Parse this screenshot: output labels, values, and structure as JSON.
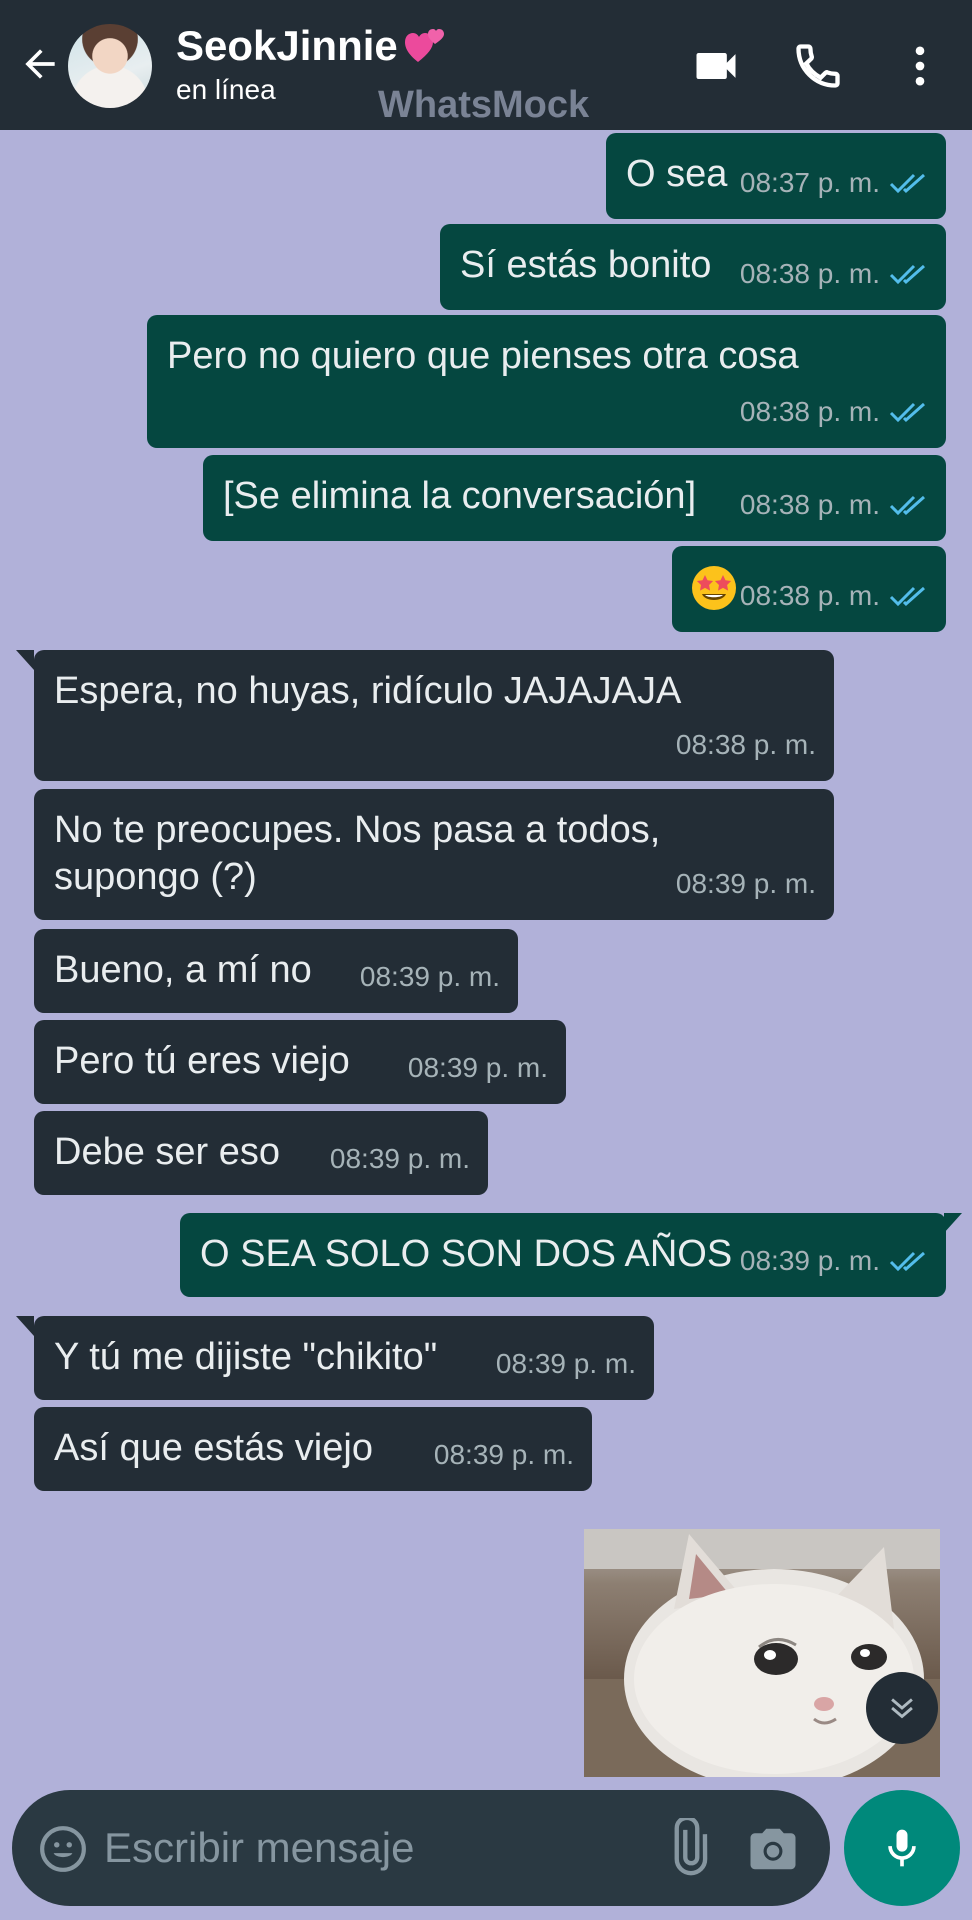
{
  "header": {
    "contact_name": "SeokJinnie",
    "status": "en línea",
    "watermark": "WhatsMock"
  },
  "messages": [
    {
      "dir": "out",
      "text": "O sea",
      "time": "08:37 p. m.",
      "read": true
    },
    {
      "dir": "out",
      "text": "Sí estás bonito",
      "time": "08:38 p. m.",
      "read": true
    },
    {
      "dir": "out",
      "text": "Pero no quiero que pienses otra cosa",
      "time": "08:38 p. m.",
      "read": true
    },
    {
      "dir": "out",
      "text": "[Se elimina la conversación]",
      "time": "08:38 p. m.",
      "read": true
    },
    {
      "dir": "out",
      "text": "",
      "emoji": "star-struck-emoji",
      "time": "08:38 p. m.",
      "read": true
    },
    {
      "dir": "in",
      "text": "Espera, no huyas, ridículo JAJAJAJA",
      "time": "08:38 p. m."
    },
    {
      "dir": "in",
      "text": "No te preocupes. Nos pasa a todos,",
      "text2": "supongo (?)",
      "time": "08:39 p. m."
    },
    {
      "dir": "in",
      "text": "Bueno, a mí no",
      "time": "08:39 p. m."
    },
    {
      "dir": "in",
      "text": "Pero tú eres viejo",
      "time": "08:39 p. m."
    },
    {
      "dir": "in",
      "text": "Debe ser eso",
      "time": "08:39 p. m."
    },
    {
      "dir": "out",
      "text": "O SEA SOLO SON DOS AÑOS",
      "time": "08:39 p. m.",
      "read": true
    },
    {
      "dir": "in",
      "text": "Y tú me dijiste \"chikito\"",
      "time": "08:39 p. m."
    },
    {
      "dir": "in",
      "text": "Así que estás viejo",
      "time": "08:39 p. m."
    }
  ],
  "sticker": {
    "subject": "crying-cat-sticker"
  },
  "composer": {
    "placeholder": "Escribir mensaje"
  },
  "icons": {
    "back": "arrow-left-icon",
    "video": "video-call-icon",
    "call": "phone-icon",
    "menu": "more-vert-icon",
    "emoji": "emoji-icon",
    "attach": "paperclip-icon",
    "camera": "camera-icon",
    "mic": "microphone-icon",
    "scroll": "double-chevron-down-icon"
  },
  "colors": {
    "header_bg": "#232d36",
    "chat_bg": "#b1b1d9",
    "outgoing_bubble": "#054740",
    "incoming_bubble": "#232d36",
    "read_ticks": "#53bdeb",
    "mic_button": "#00897b"
  }
}
